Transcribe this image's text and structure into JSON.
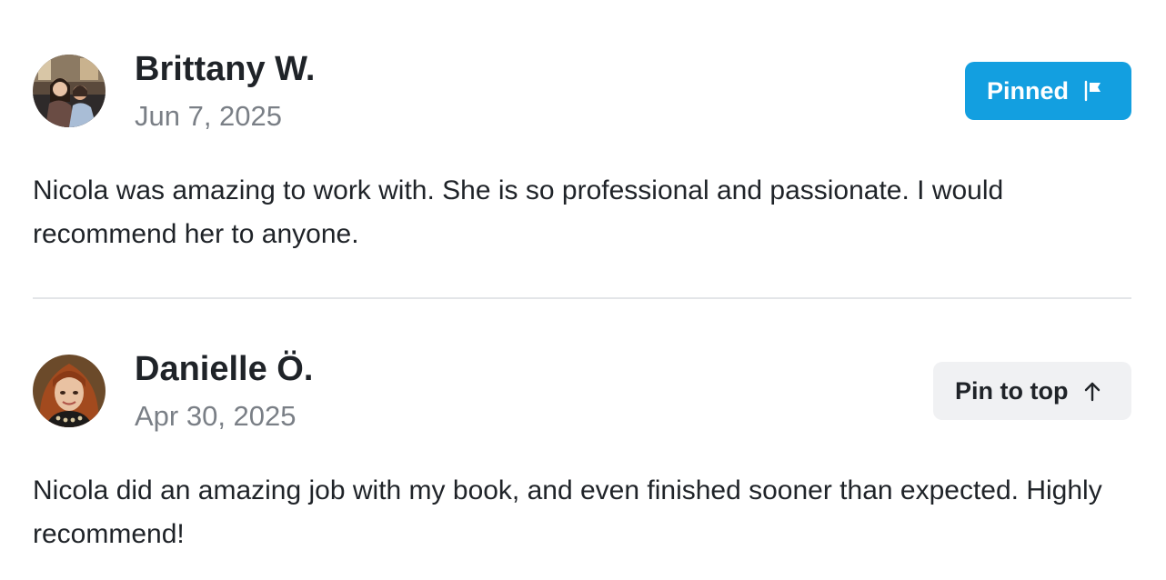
{
  "reviews": [
    {
      "name": "Brittany W.",
      "date": "Jun 7, 2025",
      "text": "Nicola was amazing to work with. She is so professional and passionate. I would recommend her to anyone.",
      "pin_label": "Pinned",
      "pin_icon": "flag-icon",
      "pin_state": "pinned"
    },
    {
      "name": "Danielle Ö.",
      "date": "Apr 30, 2025",
      "text": "Nicola did an amazing job with my book, and even finished sooner than expected. Highly recommend!",
      "pin_label": "Pin to top",
      "pin_icon": "arrow-up-icon",
      "pin_state": "unpinned"
    }
  ],
  "colors": {
    "pinned_bg": "#139fe0",
    "unpinned_bg": "#f0f1f3",
    "text": "#1f2328",
    "muted": "#7a7f86",
    "divider": "#e3e5e8"
  }
}
